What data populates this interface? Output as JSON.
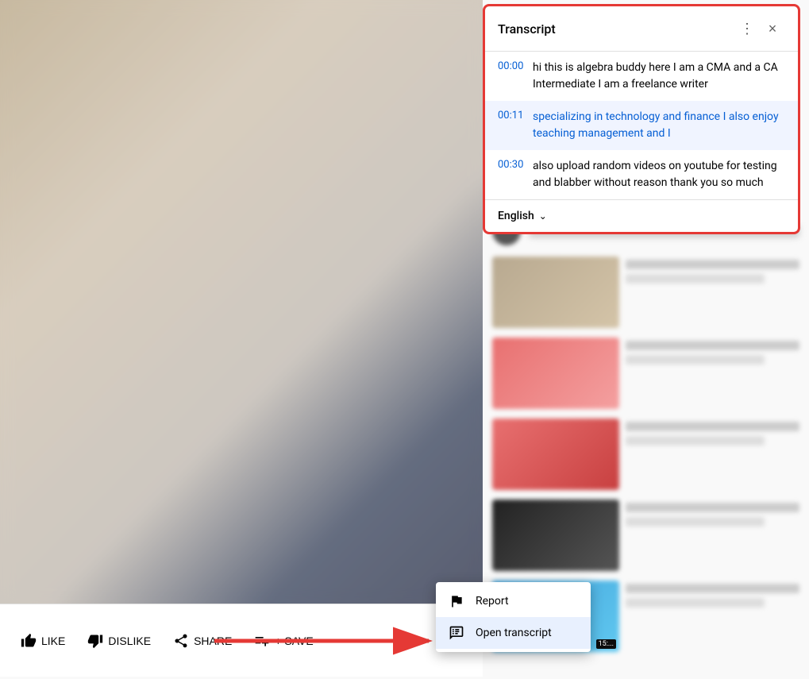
{
  "video": {
    "background_description": "Blurred video frame showing person at laptop"
  },
  "controls": {
    "like_label": "LIKE",
    "dislike_label": "DISLIKE",
    "share_label": "SHARE",
    "save_label": "+ SAVE",
    "more_label": "···"
  },
  "context_menu": {
    "items": [
      {
        "id": "report",
        "label": "Report",
        "icon": "flag"
      },
      {
        "id": "open-transcript",
        "label": "Open transcript",
        "icon": "transcript",
        "active": true
      }
    ]
  },
  "transcript": {
    "title": "Transcript",
    "items": [
      {
        "time": "00:00",
        "text_parts": [
          {
            "text": "hi this is algebra buddy here I am a CMA and  a CA Intermediate I am a freelance writer",
            "highlight": false
          }
        ],
        "highlighted": false
      },
      {
        "time": "00:11",
        "text_parts": [
          {
            "text": "specializing in technology and finance  I also enjoy teaching management and I",
            "highlight": true
          }
        ],
        "highlighted": true
      },
      {
        "time": "00:30",
        "text_parts": [
          {
            "text": "also upload random videos on youtube for testing  and blabber without reason thank you so much",
            "highlight": false
          }
        ],
        "highlighted": false
      }
    ],
    "language": "English",
    "close_label": "×",
    "more_options_label": "⋮"
  },
  "sidebar": {
    "rows": [
      {
        "thumb_class": "thumb-img-1",
        "duration": ""
      },
      {
        "thumb_class": "thumb-img-2",
        "duration": ""
      },
      {
        "thumb_class": "thumb-img-3",
        "duration": ""
      },
      {
        "thumb_class": "thumb-img-4",
        "duration": ""
      },
      {
        "thumb_class": "thumb-img-5",
        "duration": "15:..."
      }
    ]
  },
  "arrow": {
    "direction": "right",
    "color": "#e53935"
  }
}
